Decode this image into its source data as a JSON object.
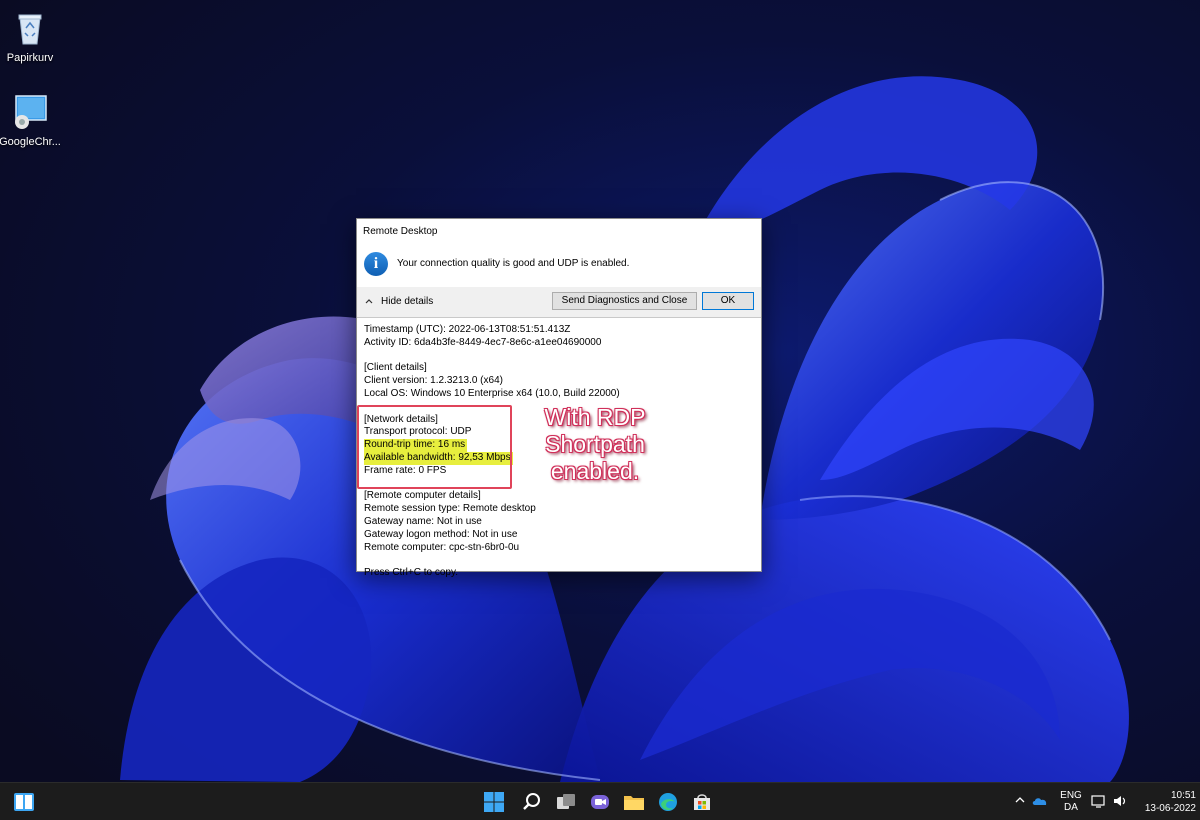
{
  "desktop": {
    "icons": [
      {
        "label": "Papirkurv",
        "icon": "recycle-bin-icon"
      },
      {
        "label": "GoogleChr...",
        "icon": "chrome-shortcut-icon"
      }
    ]
  },
  "dialog": {
    "title": "Remote Desktop",
    "message": "Your connection quality is good and UDP is enabled.",
    "hide_details_label": "Hide details",
    "send_button_label": "Send Diagnostics and Close",
    "ok_button_label": "OK",
    "details": {
      "timestamp": "Timestamp (UTC): 2022-06-13T08:51:51.413Z",
      "activity_id": "Activity ID: 6da4b3fe-8449-4ec7-8e6c-a1ee04690000",
      "client_header": "[Client details]",
      "client_version": "Client version: 1.2.3213.0 (x64)",
      "local_os": "Local OS: Windows 10 Enterprise x64 (10.0, Build 22000)",
      "network_header": "[Network details]",
      "transport": "Transport protocol: UDP",
      "rtt": "Round-trip time: 16 ms",
      "bandwidth": "Available bandwidth: 92,53 Mbps",
      "frame_rate": "Frame rate: 0 FPS",
      "remote_header": "[Remote computer details]",
      "session_type": "Remote session type: Remote desktop",
      "gateway_name": "Gateway name: Not in use",
      "gateway_logon": "Gateway logon method: Not in use",
      "remote_computer": "Remote computer: cpc-stn-6br0-0u",
      "copy_hint": "Press Ctrl+C to copy."
    }
  },
  "annotation": {
    "line1": "With RDP",
    "line2": "Shortpath",
    "line3": "enabled.",
    "color": "#e0445a"
  },
  "taskbar": {
    "language": {
      "line1": "ENG",
      "line2": "DA"
    },
    "clock": {
      "time": "10:51",
      "date": "13-06-2022"
    },
    "center_icons": [
      "start-icon",
      "search-icon",
      "task-view-icon",
      "chat-icon",
      "file-explorer-icon",
      "edge-icon",
      "store-icon"
    ],
    "left_icon": "desktop-app-icon"
  },
  "colors": {
    "highlight": "#e7ee3e",
    "taskbar": "#1c1c1c",
    "accent_blue": "#0078d7"
  }
}
